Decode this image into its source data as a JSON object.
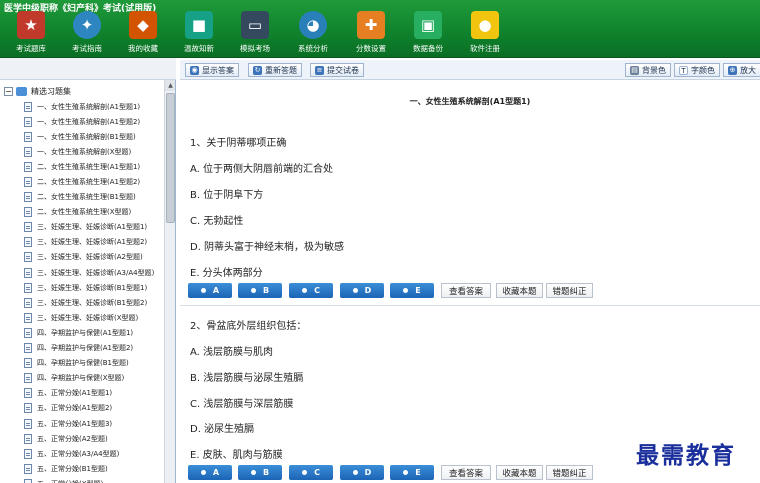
{
  "app": {
    "title": "医学中级职称《妇产科》考试(试用版)"
  },
  "toolbar": {
    "items": [
      {
        "label": "考试题库",
        "icon": "book-icon",
        "color": "#c0392b"
      },
      {
        "label": "考试指南",
        "icon": "compass-icon",
        "color": "#2e86c1"
      },
      {
        "label": "我的收藏",
        "icon": "gift-icon",
        "color": "#d35400"
      },
      {
        "label": "温故知新",
        "icon": "cube-icon",
        "color": "#16a085"
      },
      {
        "label": "模拟考场",
        "icon": "monitor-icon",
        "color": "#34495e"
      },
      {
        "label": "系统分析",
        "icon": "pie-chart-icon",
        "color": "#2980b9"
      },
      {
        "label": "分数设置",
        "icon": "tools-icon",
        "color": "#e67e22"
      },
      {
        "label": "数据备份",
        "icon": "backup-icon",
        "color": "#27ae60"
      },
      {
        "label": "软件注册",
        "icon": "lock-icon",
        "color": "#f1c40f"
      }
    ]
  },
  "tree": {
    "root_label": "精选习题集",
    "items": [
      "一、女性生殖系统解剖(A1型题1)",
      "一、女性生殖系统解剖(A1型题2)",
      "一、女性生殖系统解剖(B1型题)",
      "一、女性生殖系统解剖(X型题)",
      "二、女性生殖系统生理(A1型题1)",
      "二、女性生殖系统生理(A1型题2)",
      "二、女性生殖系统生理(B1型题)",
      "二、女性生殖系统生理(X型题)",
      "三、妊娠生理、妊娠诊断(A1型题1)",
      "三、妊娠生理、妊娠诊断(A1型题2)",
      "三、妊娠生理、妊娠诊断(A2型题)",
      "三、妊娠生理、妊娠诊断(A3/A4型题)",
      "三、妊娠生理、妊娠诊断(B1型题1)",
      "三、妊娠生理、妊娠诊断(B1型题2)",
      "三、妊娠生理、妊娠诊断(X型题)",
      "四、孕期监护与保健(A1型题1)",
      "四、孕期监护与保健(A1型题2)",
      "四、孕期监护与保健(B1型题)",
      "四、孕期监护与保健(X型题)",
      "五、正常分娩(A1型题1)",
      "五、正常分娩(A1型题2)",
      "五、正常分娩(A1型题3)",
      "五、正常分娩(A2型题)",
      "五、正常分娩(A3/A4型题)",
      "五、正常分娩(B1型题)",
      "五、正常分娩(X型题)"
    ]
  },
  "actions": {
    "show_answer": "显示答案",
    "redo": "重新答题",
    "submit": "提交试卷",
    "bg_color": "背景色",
    "font_color": "字颜色",
    "zoom": "放大"
  },
  "content": {
    "section_title": "一、女性生殖系统解剖(A1型题1)",
    "questions": [
      {
        "title": "1、关于阴蒂哪项正确",
        "options": [
          "A.  位于两侧大阴唇前端的汇合处",
          "B.  位于阴阜下方",
          "C.  无勃起性",
          "D.  阴蒂头富于神经末梢，极为敏感",
          "E.  分头体两部分"
        ]
      },
      {
        "title": "2、骨盆底外层组织包括：",
        "options": [
          "A.  浅层筋膜与肌肉",
          "B.  浅层筋膜与泌尿生殖膈",
          "C.  浅层筋膜与深层筋膜",
          "D.  泌尿生殖膈",
          "E.  皮肤、肌肉与筋膜"
        ]
      }
    ],
    "answer_buttons": [
      "A",
      "B",
      "C",
      "D",
      "E"
    ],
    "tools": {
      "view_answer": "查看答案",
      "favorite": "收藏本题",
      "report_error": "错题纠正"
    }
  },
  "watermark": "最需教育"
}
